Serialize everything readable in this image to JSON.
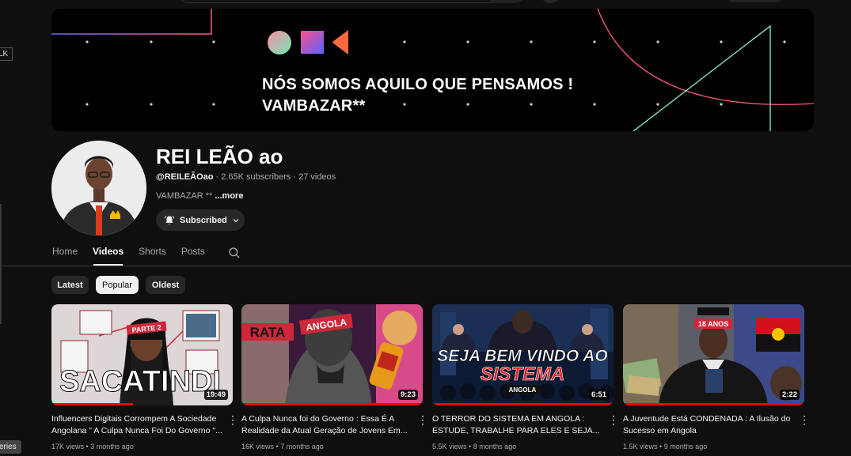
{
  "banner": {
    "slogan_line1": "NÓS SOMOS AQUILO QUE PENSAMOS !",
    "slogan_line2": "VAMBAZAR**"
  },
  "side": {
    "tag": "LK",
    "tooltip": "eries"
  },
  "channel": {
    "name": "REI LEÃO ao",
    "handle": "@REILEÃOao",
    "subscribers": "2.65K subscribers",
    "videos_count": "27 videos",
    "sep": " · ",
    "description": "VAMBAZAR  **",
    "more_label": "...more",
    "subscribed_label": "Subscribed"
  },
  "tabs": {
    "home": "Home",
    "videos": "Videos",
    "shorts": "Shorts",
    "posts": "Posts"
  },
  "chips": {
    "latest": "Latest",
    "popular": "Popular",
    "oldest": "Oldest"
  },
  "videos": [
    {
      "title": "Influencers Digitais Corrompem A Sociedade Angolana \" A Culpa Nunca Foi Do Governo \"...",
      "views": "17K views",
      "age": "3 months ago",
      "duration": "19:49",
      "thumb_text_main": "SACATINDI",
      "thumb_text_tag": "PARTE 2",
      "watched": 0.45
    },
    {
      "title": "A Culpa Nunca foi do Governo : Essa É A Realidade da Atual Geração de Jovens Em...",
      "views": "16K views",
      "age": "7 months ago",
      "duration": "9:23",
      "thumb_text_main": "RATA",
      "thumb_text_tag": "ANGOLA",
      "watched": 1.0
    },
    {
      "title": "O TERROR DO SISTEMA EM ANGOLA : ESTUDE, TRABALHE PARA ELES E SEJA...",
      "views": "5.5K views",
      "age": "8 months ago",
      "duration": "6:51",
      "thumb_text_main": "SEJA BEM VINDO AO",
      "thumb_text_sub": "SISTEMA",
      "thumb_text_tag": "ANGOLA",
      "watched": 1.0
    },
    {
      "title": "A Juventude Está CONDENADA : A Ilusão do Sucesso em Angola",
      "views": "1.5K views",
      "age": "9 months ago",
      "duration": "2:22",
      "thumb_text_tag": "18 ANOS",
      "watched": 1.0
    }
  ],
  "colors": {
    "background": "#0f0f0f",
    "chip_bg": "#272727",
    "progress": "#ff0000"
  }
}
